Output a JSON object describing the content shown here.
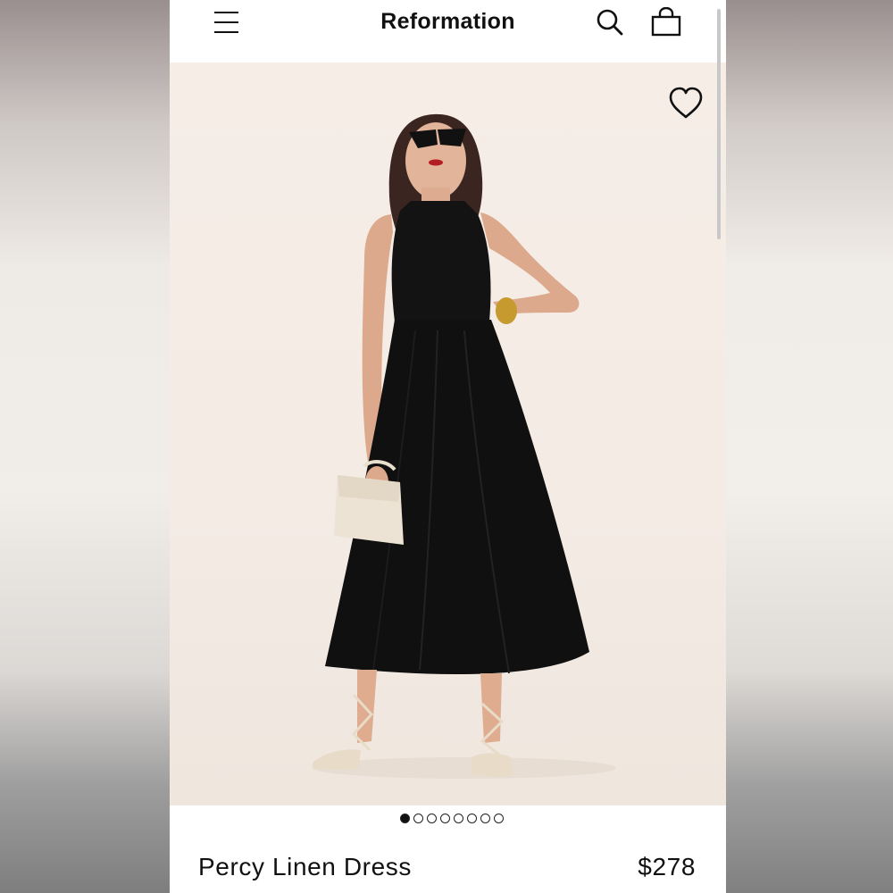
{
  "header": {
    "brand": "Reformation",
    "icons": [
      "menu-icon",
      "search-icon",
      "shopping-bag-icon"
    ]
  },
  "gallery": {
    "total_images": 8,
    "active_index": 0,
    "favorite_icon": "heart-icon"
  },
  "product": {
    "name": "Percy Linen Dress",
    "price": "$278"
  },
  "colors": {
    "text": "#111111",
    "hero_bg": "#f3ebe4",
    "dress": "#111111",
    "bag": "#ece3d4"
  }
}
